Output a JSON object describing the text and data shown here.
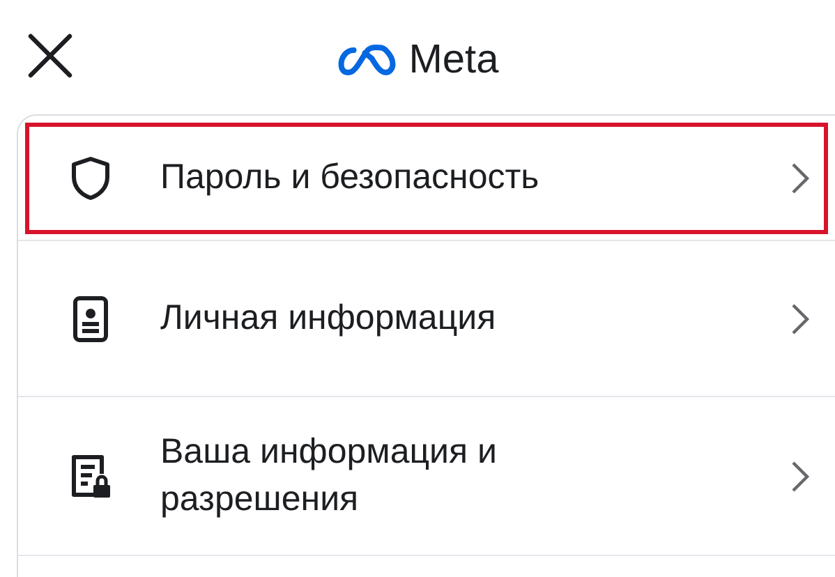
{
  "header": {
    "logo_text": "Meta"
  },
  "items": [
    {
      "kind": "shield",
      "label": "Пароль и безопасность",
      "highlighted": true
    },
    {
      "kind": "id-card",
      "label": "Личная информация",
      "highlighted": false
    },
    {
      "kind": "doc-lock",
      "label": "Ваша информация и разрешения",
      "highlighted": false
    }
  ]
}
